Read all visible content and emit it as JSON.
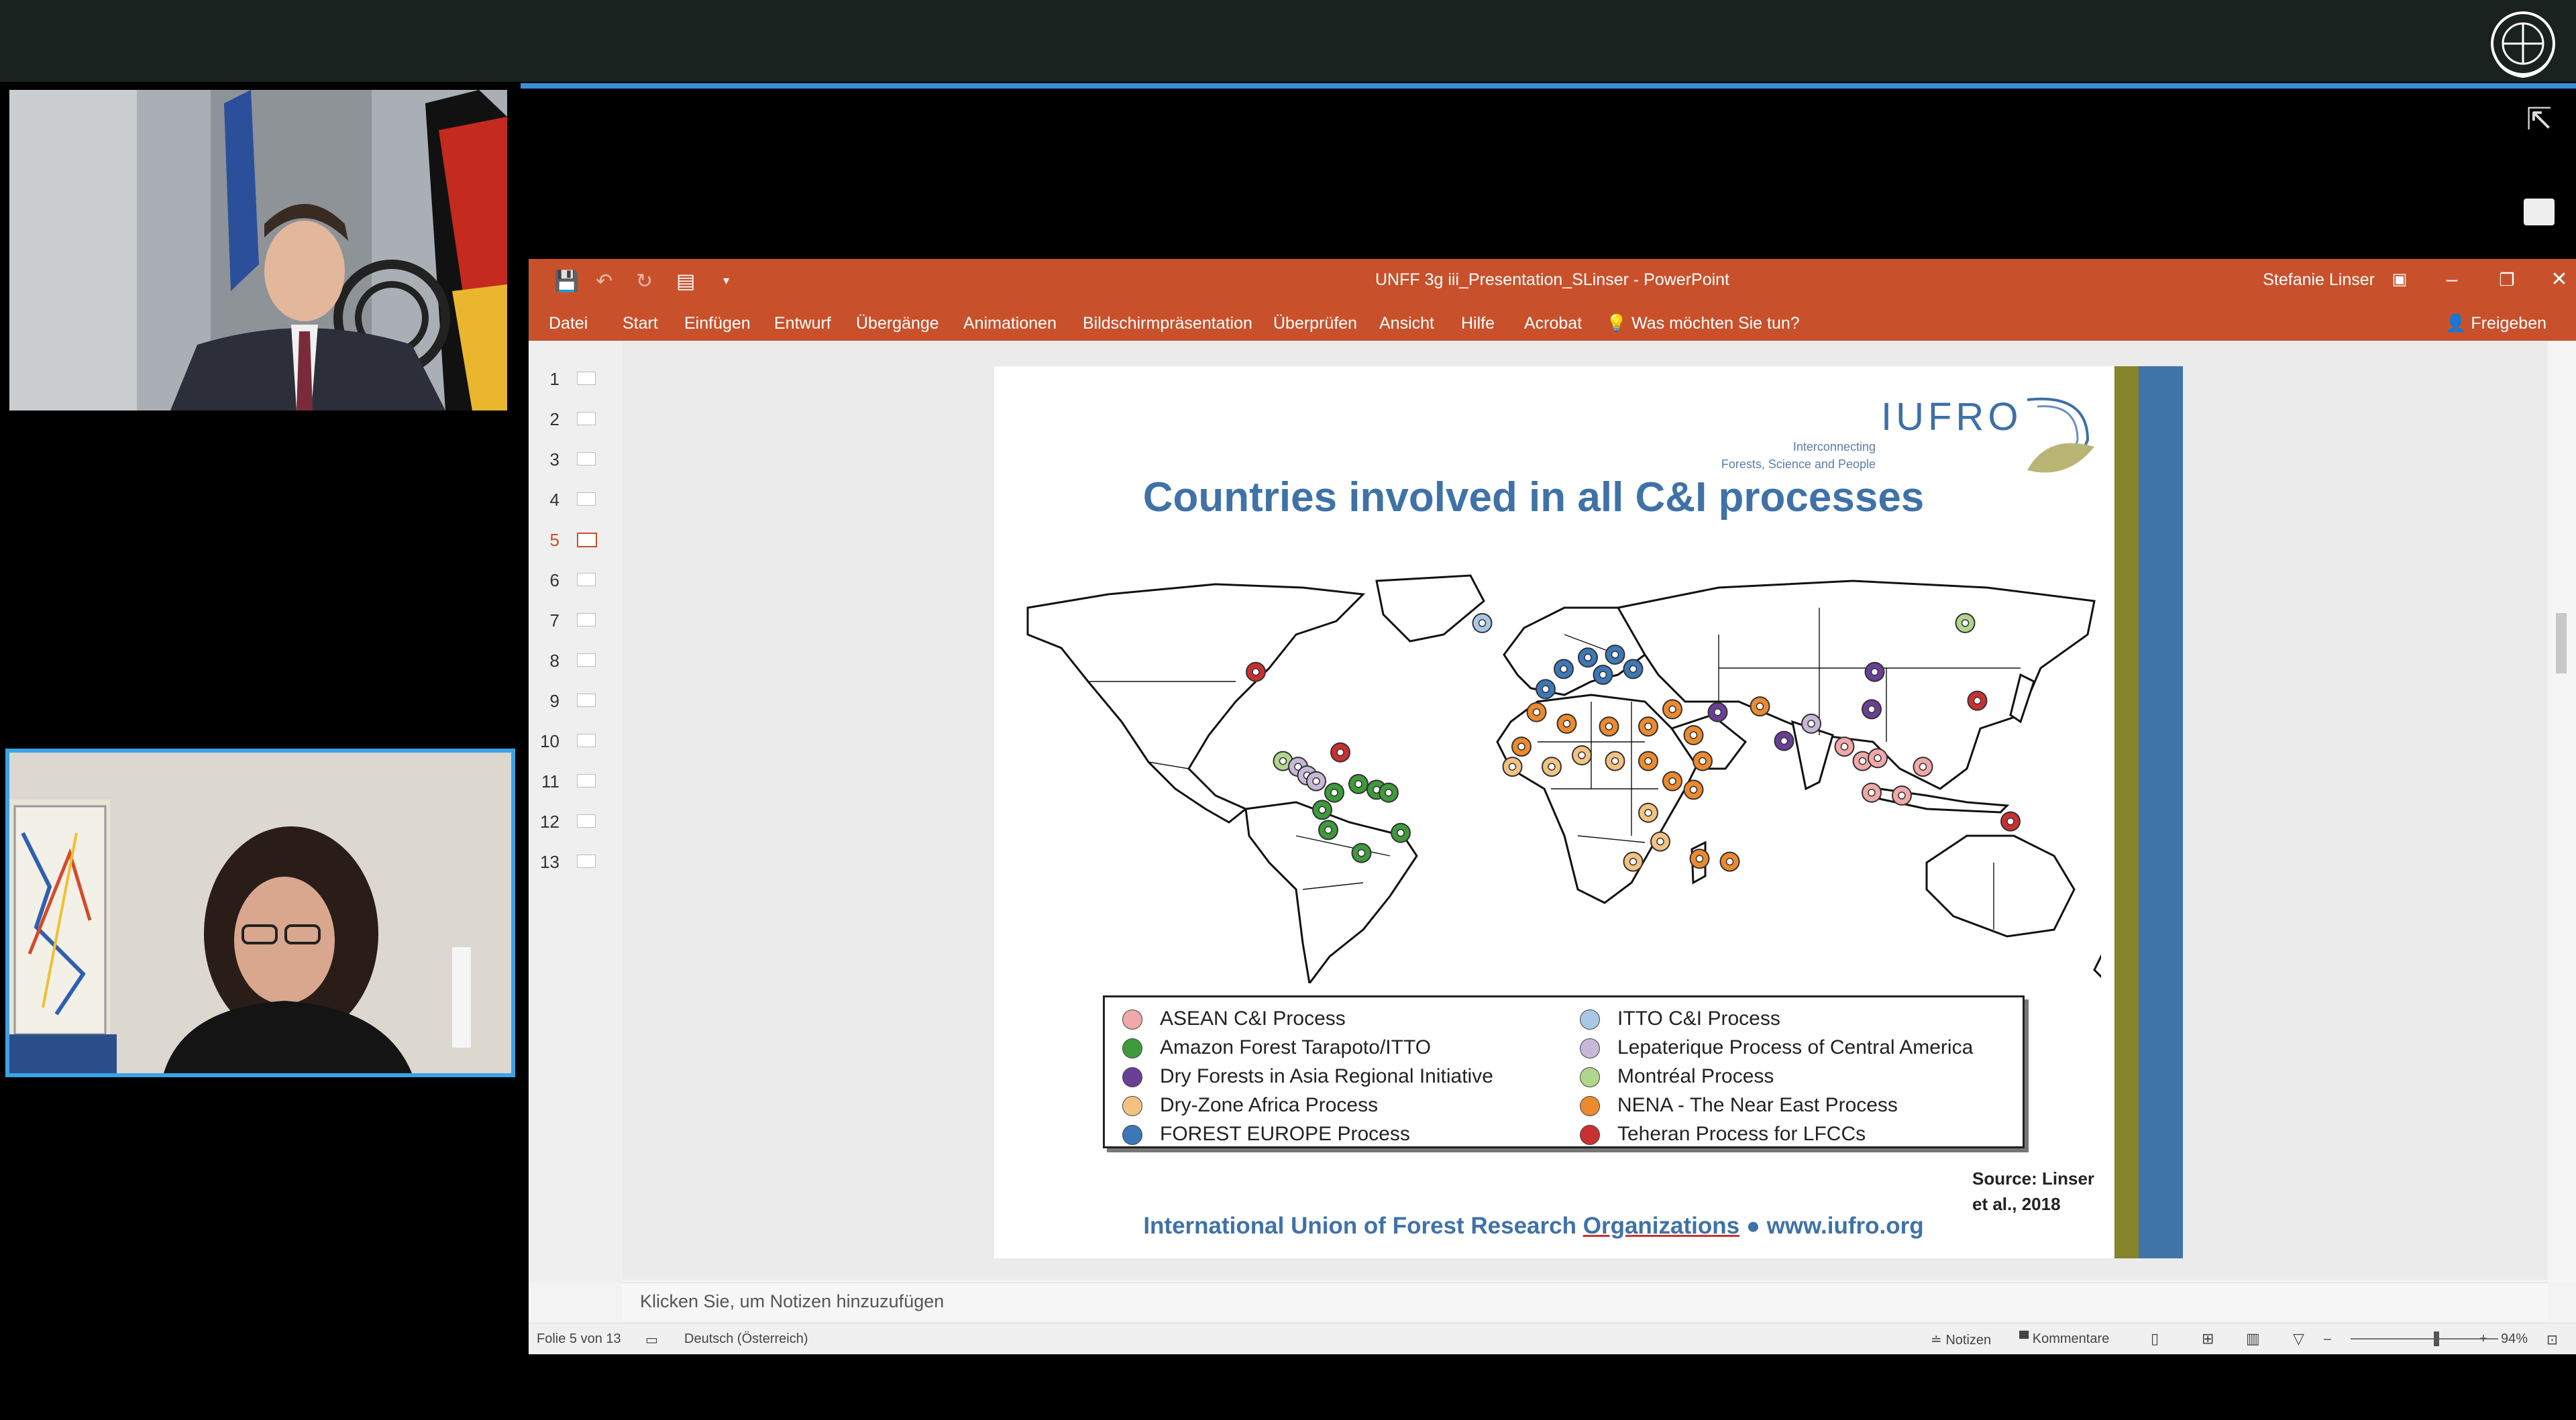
{
  "window": {
    "title": "UNFF 3g iii_Presentation_SLinser  -  PowerPoint",
    "user": "Stefanie Linser"
  },
  "ribbon": {
    "tabs": [
      "Datei",
      "Start",
      "Einfügen",
      "Entwurf",
      "Übergänge",
      "Animationen",
      "Bildschirmpräsentation",
      "Überprüfen",
      "Ansicht",
      "Hilfe",
      "Acrobat"
    ],
    "tell_me": "Was möchten Sie tun?",
    "share": "Freigeben"
  },
  "thumbnails": [
    "1",
    "2",
    "3",
    "4",
    "5",
    "6",
    "7",
    "8",
    "9",
    "10",
    "11",
    "12",
    "13"
  ],
  "active_slide": 5,
  "slide": {
    "logo": "IUFRO",
    "tagline1": "Interconnecting",
    "tagline2": "Forests, Science and People",
    "title": "Countries involved in all C&I processes",
    "legend": [
      {
        "label": "ASEAN C&I Process",
        "color": "#f0a8a8"
      },
      {
        "label": "Amazon Forest Tarapoto/ITTO",
        "color": "#3f9a3c"
      },
      {
        "label": "Dry Forests in Asia Regional Initiative",
        "color": "#6a3f96"
      },
      {
        "label": "Dry-Zone Africa Process",
        "color": "#f3c282"
      },
      {
        "label": "FOREST EUROPE Process",
        "color": "#3c78b8"
      },
      {
        "label": "ITTO C&I Process",
        "color": "#a9c8e6"
      },
      {
        "label": "Lepaterique Process of Central America",
        "color": "#c6b8d6"
      },
      {
        "label": "Montréal Process",
        "color": "#b0d68c"
      },
      {
        "label": "NENA - The Near East Process",
        "color": "#ec8a2e"
      },
      {
        "label": "Teheran Process for LFCCs",
        "color": "#c93030"
      }
    ],
    "source": "Source: Linser et al., 2018",
    "footer_a": "International Union of Forest Research ",
    "footer_b": "Organizations",
    "footer_c": " ● www.iufro.org"
  },
  "notes_placeholder": "Klicken Sie, um Notizen hinzuzufügen",
  "status": {
    "slide_info": "Folie 5 von 13",
    "language": "Deutsch (Österreich)",
    "notes": "Notizen",
    "comments": "Kommentare",
    "zoom": "94%"
  },
  "map_markers": [
    {
      "lon": -25,
      "lat": 63,
      "color": "#a9c8e6"
    },
    {
      "lon": -100,
      "lat": 46,
      "color": "#c93030"
    },
    {
      "lon": -91,
      "lat": 15,
      "color": "#b0d68c"
    },
    {
      "lon": -86,
      "lat": 13,
      "color": "#c6b8d6"
    },
    {
      "lon": -83,
      "lat": 10,
      "color": "#c6b8d6"
    },
    {
      "lon": -80,
      "lat": 8,
      "color": "#c6b8d6"
    },
    {
      "lon": -74,
      "lat": 4,
      "color": "#3f9a3c"
    },
    {
      "lon": -66,
      "lat": 7,
      "color": "#3f9a3c"
    },
    {
      "lon": -60,
      "lat": 5,
      "color": "#3f9a3c"
    },
    {
      "lon": -78,
      "lat": -2,
      "color": "#3f9a3c"
    },
    {
      "lon": -76,
      "lat": -9,
      "color": "#3f9a3c"
    },
    {
      "lon": -65,
      "lat": -17,
      "color": "#3f9a3c"
    },
    {
      "lon": -52,
      "lat": -10,
      "color": "#3f9a3c"
    },
    {
      "lon": -56,
      "lat": 4,
      "color": "#3f9a3c"
    },
    {
      "lon": -72,
      "lat": 18,
      "color": "#c93030"
    },
    {
      "lon": -4,
      "lat": 40,
      "color": "#3c78b8"
    },
    {
      "lon": 2,
      "lat": 47,
      "color": "#3c78b8"
    },
    {
      "lon": 10,
      "lat": 51,
      "color": "#3c78b8"
    },
    {
      "lon": 19,
      "lat": 52,
      "color": "#3c78b8"
    },
    {
      "lon": 25,
      "lat": 47,
      "color": "#3c78b8"
    },
    {
      "lon": 15,
      "lat": 45,
      "color": "#3c78b8"
    },
    {
      "lon": -7,
      "lat": 32,
      "color": "#ec8a2e"
    },
    {
      "lon": 3,
      "lat": 28,
      "color": "#ec8a2e"
    },
    {
      "lon": 17,
      "lat": 27,
      "color": "#ec8a2e"
    },
    {
      "lon": 30,
      "lat": 27,
      "color": "#ec8a2e"
    },
    {
      "lon": 38,
      "lat": 33,
      "color": "#ec8a2e"
    },
    {
      "lon": 45,
      "lat": 24,
      "color": "#ec8a2e"
    },
    {
      "lon": 48,
      "lat": 15,
      "color": "#ec8a2e"
    },
    {
      "lon": 30,
      "lat": 15,
      "color": "#ec8a2e"
    },
    {
      "lon": -12,
      "lat": 20,
      "color": "#ec8a2e"
    },
    {
      "lon": -15,
      "lat": 13,
      "color": "#f3c282"
    },
    {
      "lon": -2,
      "lat": 13,
      "color": "#f3c282"
    },
    {
      "lon": 8,
      "lat": 17,
      "color": "#f3c282"
    },
    {
      "lon": 19,
      "lat": 15,
      "color": "#f3c282"
    },
    {
      "lon": 38,
      "lat": 8,
      "color": "#ec8a2e"
    },
    {
      "lon": 45,
      "lat": 5,
      "color": "#ec8a2e"
    },
    {
      "lon": 30,
      "lat": -3,
      "color": "#f3c282"
    },
    {
      "lon": 34,
      "lat": -13,
      "color": "#f3c282"
    },
    {
      "lon": 25,
      "lat": -20,
      "color": "#f3c282"
    },
    {
      "lon": 47,
      "lat": -19,
      "color": "#ec8a2e"
    },
    {
      "lon": 57,
      "lat": -20,
      "color": "#ec8a2e"
    },
    {
      "lon": 53,
      "lat": 32,
      "color": "#6a3f96"
    },
    {
      "lon": 67,
      "lat": 34,
      "color": "#ec8a2e"
    },
    {
      "lon": 75,
      "lat": 22,
      "color": "#6a3f96"
    },
    {
      "lon": 84,
      "lat": 28,
      "color": "#c6b8d6"
    },
    {
      "lon": 95,
      "lat": 20,
      "color": "#f0a8a8"
    },
    {
      "lon": 101,
      "lat": 15,
      "color": "#f0a8a8"
    },
    {
      "lon": 106,
      "lat": 16,
      "color": "#f0a8a8"
    },
    {
      "lon": 104,
      "lat": 4,
      "color": "#f0a8a8"
    },
    {
      "lon": 114,
      "lat": 3,
      "color": "#f0a8a8"
    },
    {
      "lon": 121,
      "lat": 13,
      "color": "#f0a8a8"
    },
    {
      "lon": 105,
      "lat": 46,
      "color": "#6a3f96"
    },
    {
      "lon": 104,
      "lat": 33,
      "color": "#6a3f96"
    },
    {
      "lon": 135,
      "lat": 63,
      "color": "#b0d68c"
    },
    {
      "lon": 139,
      "lat": 36,
      "color": "#c93030"
    },
    {
      "lon": 150,
      "lat": -6,
      "color": "#c93030"
    }
  ]
}
